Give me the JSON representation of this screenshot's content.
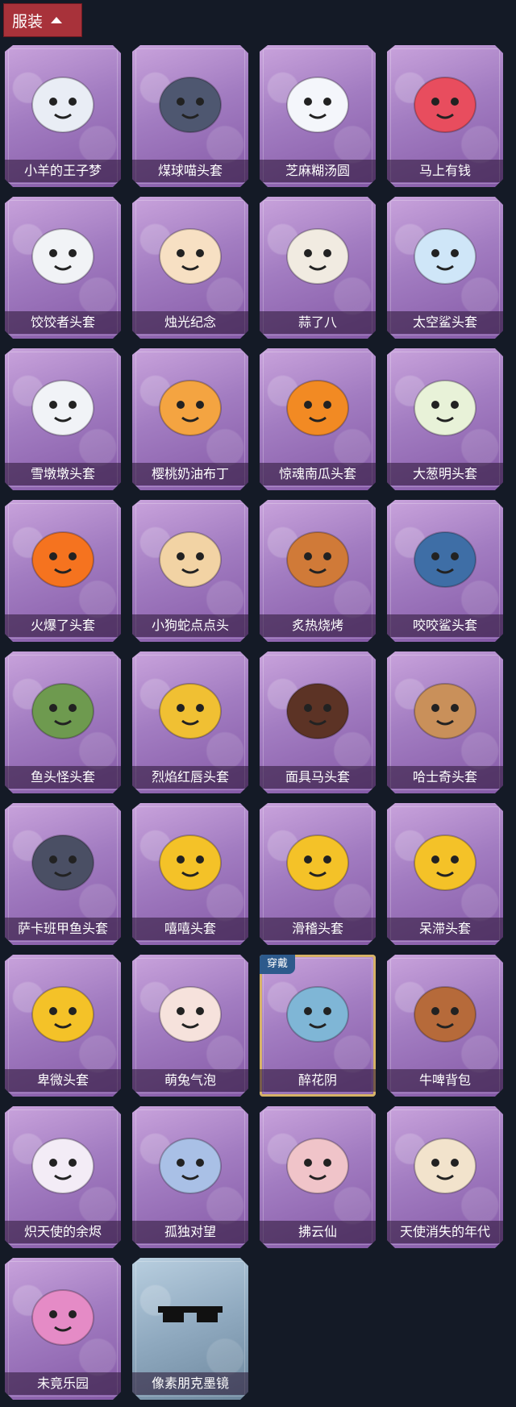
{
  "header": {
    "title": "服装"
  },
  "items": [
    {
      "label": "小羊的王子梦",
      "icon": "sheep-prince-head-icon",
      "color": "#e9edf5"
    },
    {
      "label": "煤球喵头套",
      "icon": "cat-head-icon",
      "color": "#4e5770"
    },
    {
      "label": "芝麻糊汤圆",
      "icon": "rice-ball-head-icon",
      "color": "#f4f6fb"
    },
    {
      "label": "马上有钱",
      "icon": "horse-head-icon",
      "color": "#e84d5e"
    },
    {
      "label": "饺饺者头套",
      "icon": "dumpling-head-icon",
      "color": "#f1f3f6"
    },
    {
      "label": "烛光纪念",
      "icon": "candle-head-icon",
      "color": "#f7e0c3"
    },
    {
      "label": "蒜了八",
      "icon": "garlic-head-icon",
      "color": "#f1ebe1"
    },
    {
      "label": "太空鲨头套",
      "icon": "space-shark-head-icon",
      "color": "#cfe6f8"
    },
    {
      "label": "雪墩墩头套",
      "icon": "snowman-head-icon",
      "color": "#f1f3f7"
    },
    {
      "label": "樱桃奶油布丁",
      "icon": "pudding-head-icon",
      "color": "#f4a441"
    },
    {
      "label": "惊魂南瓜头套",
      "icon": "pumpkin-head-icon",
      "color": "#f28a23"
    },
    {
      "label": "大葱明头套",
      "icon": "scallion-head-icon",
      "color": "#e8f2d8"
    },
    {
      "label": "火爆了头套",
      "icon": "fire-head-icon",
      "color": "#f5731f"
    },
    {
      "label": "小狗蛇点点头",
      "icon": "dog-snake-head-icon",
      "color": "#f2d3a4"
    },
    {
      "label": "炙热烧烤",
      "icon": "barbecue-head-icon",
      "color": "#d07a38"
    },
    {
      "label": "咬咬鲨头套",
      "icon": "shark-head-icon",
      "color": "#3e6ea6"
    },
    {
      "label": "鱼头怪头套",
      "icon": "fish-head-icon",
      "color": "#6e9a4f"
    },
    {
      "label": "烈焰红唇头套",
      "icon": "yellow-mouse-head-icon",
      "color": "#f0c033"
    },
    {
      "label": "面具马头套",
      "icon": "horse-mask-head-icon",
      "color": "#5c3325"
    },
    {
      "label": "哈士奇头套",
      "icon": "husky-head-icon",
      "color": "#c9905a"
    },
    {
      "label": "萨卡班甲鱼头套",
      "icon": "fish-fossil-head-icon",
      "color": "#4a4f64"
    },
    {
      "label": "嘻嘻头套",
      "icon": "grin-emoji-head-icon",
      "color": "#f4c228"
    },
    {
      "label": "滑稽头套",
      "icon": "funny-emoji-head-icon",
      "color": "#f4c228"
    },
    {
      "label": "呆滞头套",
      "icon": "stare-emoji-head-icon",
      "color": "#f4c228"
    },
    {
      "label": "卑微头套",
      "icon": "humble-emoji-head-icon",
      "color": "#f4c228"
    },
    {
      "label": "萌兔气泡",
      "icon": "bunny-bubble-icon",
      "color": "#f6e2dc"
    },
    {
      "label": "醉花阴",
      "icon": "flower-ornament-icon",
      "color": "#7fb6d6",
      "equipped": true,
      "badge": "穿戴"
    },
    {
      "label": "牛啤背包",
      "icon": "cow-beer-backpack-icon",
      "color": "#b66a3a"
    },
    {
      "label": "炽天使的余烬",
      "icon": "angel-doll-icon",
      "color": "#f3ecf6"
    },
    {
      "label": "孤独对望",
      "icon": "charm-doll-icon",
      "color": "#a9c0e6"
    },
    {
      "label": "拂云仙",
      "icon": "fairy-charm-icon",
      "color": "#f0c4c9"
    },
    {
      "label": "天使消失的年代",
      "icon": "angel-halo-doll-icon",
      "color": "#f2e3cc"
    },
    {
      "label": "未竟乐园",
      "icon": "pink-doll-icon",
      "color": "#e58bc6"
    },
    {
      "label": "像素朋克墨镜",
      "icon": "pixel-sunglasses-icon",
      "color": "#111111",
      "gray": true
    }
  ]
}
